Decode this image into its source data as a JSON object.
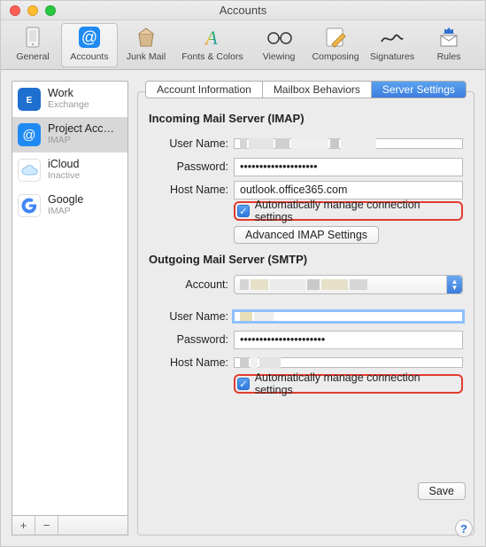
{
  "window": {
    "title": "Accounts"
  },
  "toolbar": [
    {
      "name": "general",
      "label": "General"
    },
    {
      "name": "accounts",
      "label": "Accounts",
      "selected": true
    },
    {
      "name": "junkmail",
      "label": "Junk Mail"
    },
    {
      "name": "fonts",
      "label": "Fonts & Colors"
    },
    {
      "name": "viewing",
      "label": "Viewing"
    },
    {
      "name": "composing",
      "label": "Composing"
    },
    {
      "name": "signatures",
      "label": "Signatures"
    },
    {
      "name": "rules",
      "label": "Rules"
    }
  ],
  "sidebar": {
    "accounts": [
      {
        "name": "Work",
        "sub": "Exchange",
        "icon": "exchange"
      },
      {
        "name": "Project Acc…",
        "sub": "IMAP",
        "icon": "at",
        "selected": true
      },
      {
        "name": "iCloud",
        "sub": "Inactive",
        "icon": "icloud"
      },
      {
        "name": "Google",
        "sub": "IMAP",
        "icon": "google"
      }
    ],
    "add_label": "+",
    "remove_label": "−"
  },
  "tabs": [
    {
      "id": "info",
      "label": "Account Information"
    },
    {
      "id": "behav",
      "label": "Mailbox Behaviors"
    },
    {
      "id": "server",
      "label": "Server Settings",
      "active": true
    }
  ],
  "incoming": {
    "title": "Incoming Mail Server (IMAP)",
    "username_label": "User Name:",
    "username_value": "",
    "password_label": "Password:",
    "password_value": "••••••••••••••••••••",
    "hostname_label": "Host Name:",
    "hostname_value": "outlook.office365.com",
    "auto_label": "Automatically manage connection settings",
    "auto_checked": true,
    "advanced_label": "Advanced IMAP Settings"
  },
  "outgoing": {
    "title": "Outgoing Mail Server (SMTP)",
    "account_label": "Account:",
    "account_value": "",
    "username_label": "User Name:",
    "username_value": "",
    "password_label": "Password:",
    "password_value": "••••••••••••••••••••••",
    "hostname_label": "Host Name:",
    "hostname_value": "",
    "auto_label": "Automatically manage connection settings",
    "auto_checked": true
  },
  "buttons": {
    "save": "Save",
    "help": "?"
  },
  "colors": {
    "accent": "#3d7ee0",
    "highlight_border": "#e33b30"
  }
}
